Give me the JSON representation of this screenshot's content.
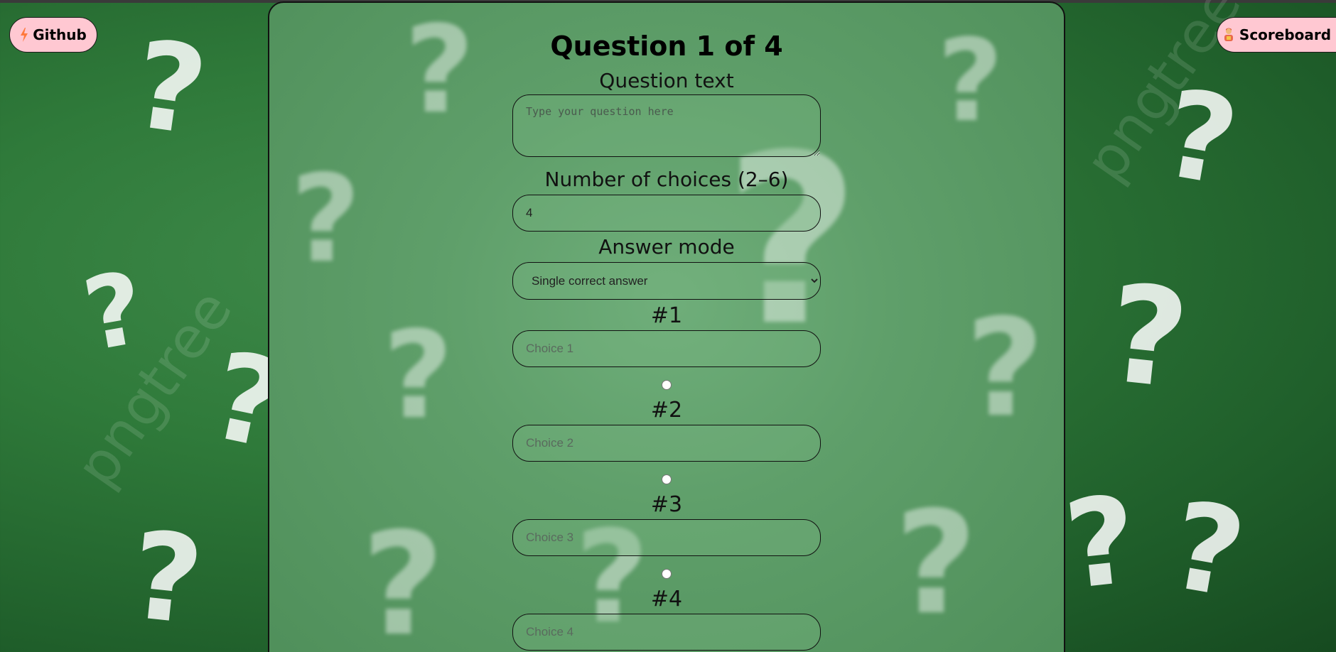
{
  "header": {
    "github_label": "Github",
    "github_icon": "lightning-icon",
    "scoreboard_label": "Scoreboard",
    "scoreboard_icon": "trophy-person-icon"
  },
  "form": {
    "title": "Question 1 of 4",
    "question_label": "Question text",
    "question_placeholder": "Type your question here",
    "question_value": "",
    "num_choices_label": "Number of choices (2–6)",
    "num_choices_value": "4",
    "answer_mode_label": "Answer mode",
    "answer_mode_selected": "Single correct answer",
    "choices": [
      {
        "label": "#1",
        "placeholder": "Choice 1",
        "value": "",
        "correct": false
      },
      {
        "label": "#2",
        "placeholder": "Choice 2",
        "value": "",
        "correct": false
      },
      {
        "label": "#3",
        "placeholder": "Choice 3",
        "value": "",
        "correct": false
      },
      {
        "label": "#4",
        "placeholder": "Choice 4",
        "value": "",
        "correct": false
      }
    ]
  },
  "colors": {
    "button_bg": "#ffc8d2",
    "background": "#2f7a3a"
  }
}
